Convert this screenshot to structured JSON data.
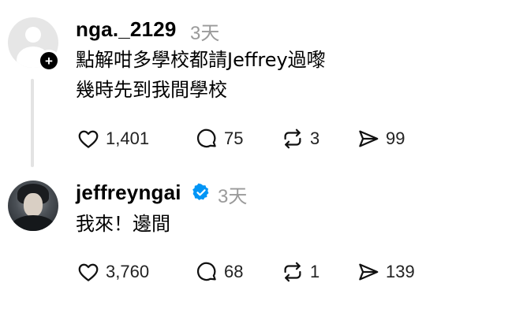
{
  "comments": [
    {
      "username": "nga._2129",
      "time": "3天",
      "lines": [
        "點解咁多學校都請Jeffrey過嚟",
        "幾時先到我間學校"
      ],
      "likes": "1,401",
      "replies": "75",
      "reposts": "3",
      "shares": "99"
    },
    {
      "username": "jeffreyngai",
      "verified": true,
      "time": "3天",
      "lines": [
        "我來！邊間"
      ],
      "likes": "3,760",
      "replies": "68",
      "reposts": "1",
      "shares": "139"
    }
  ],
  "colors": {
    "verified_badge": "#0095f6",
    "muted_text": "#9a9a9a",
    "thread_line": "#e3e3e3"
  },
  "icons": [
    "heart-icon",
    "comment-icon",
    "repost-icon",
    "share-icon",
    "plus-icon",
    "verified-icon"
  ]
}
